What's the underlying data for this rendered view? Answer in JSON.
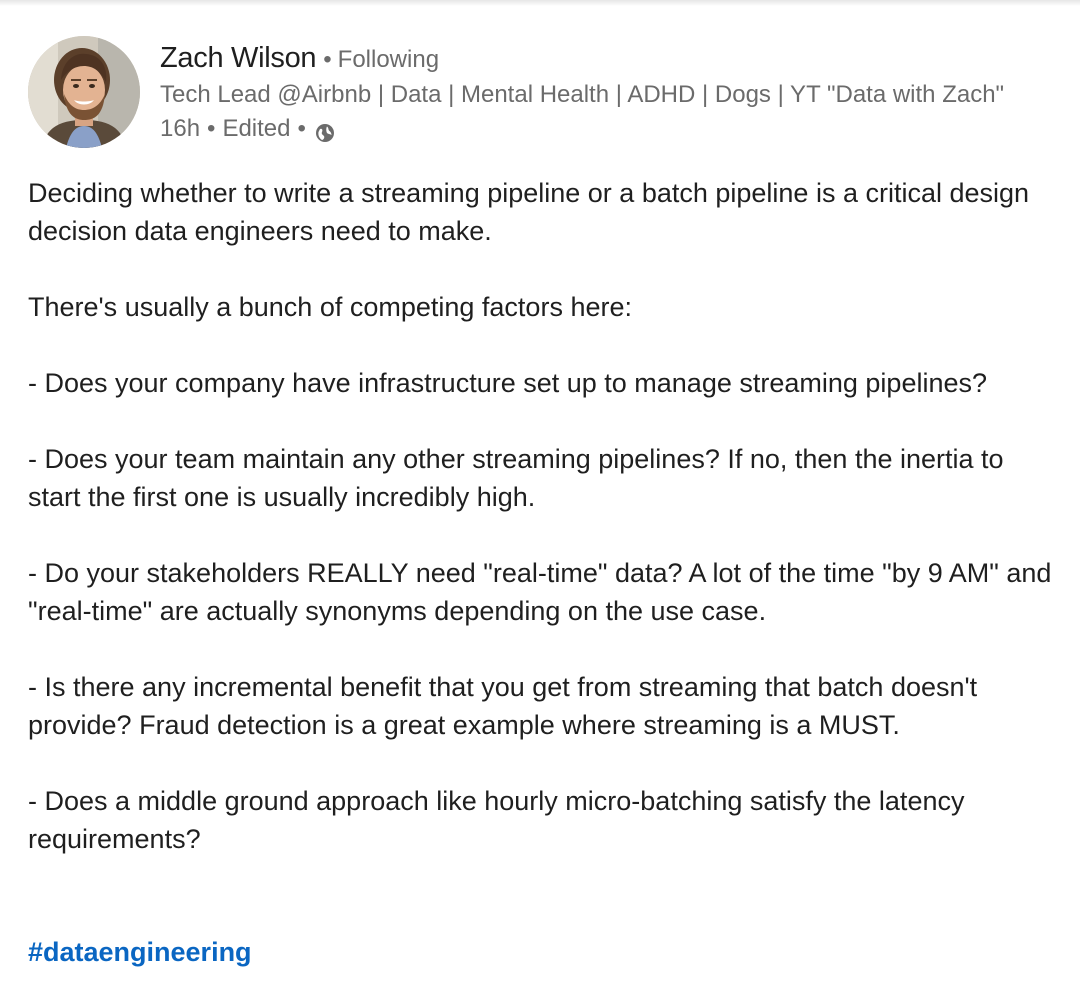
{
  "post": {
    "author": {
      "name": "Zach Wilson",
      "separator": "•",
      "follow_status": "Following",
      "headline": "Tech Lead @Airbnb | Data | Mental Health | ADHD | Dogs | YT \"Data with Zach\"",
      "time": "16h",
      "edited": "Edited",
      "visibility_icon": "globe-icon"
    },
    "paragraphs": [
      "Deciding whether to write a streaming pipeline or a batch pipeline is a critical design decision data engineers need to make.",
      "There's usually a bunch of competing factors here:",
      "- Does your company have infrastructure set up to manage streaming pipelines?",
      "- Does your team maintain any other streaming pipelines? If no, then the inertia to start the first one is usually incredibly high.",
      "- Do your stakeholders REALLY need \"real-time\" data? A lot of the time \"by 9 AM\" and \"real-time\" are actually synonyms depending on the use case.",
      "- Is there any incremental benefit that you get from streaming that batch doesn't provide? Fraud detection is a great example where streaming is a MUST.",
      "- Does a middle ground approach like hourly micro-batching satisfy the latency requirements?"
    ],
    "hashtag": "#dataengineering"
  },
  "colors": {
    "text_primary": "#1f1f1f",
    "text_secondary": "#6b6b6b",
    "link_blue": "#0a66c2",
    "background": "#ffffff"
  }
}
